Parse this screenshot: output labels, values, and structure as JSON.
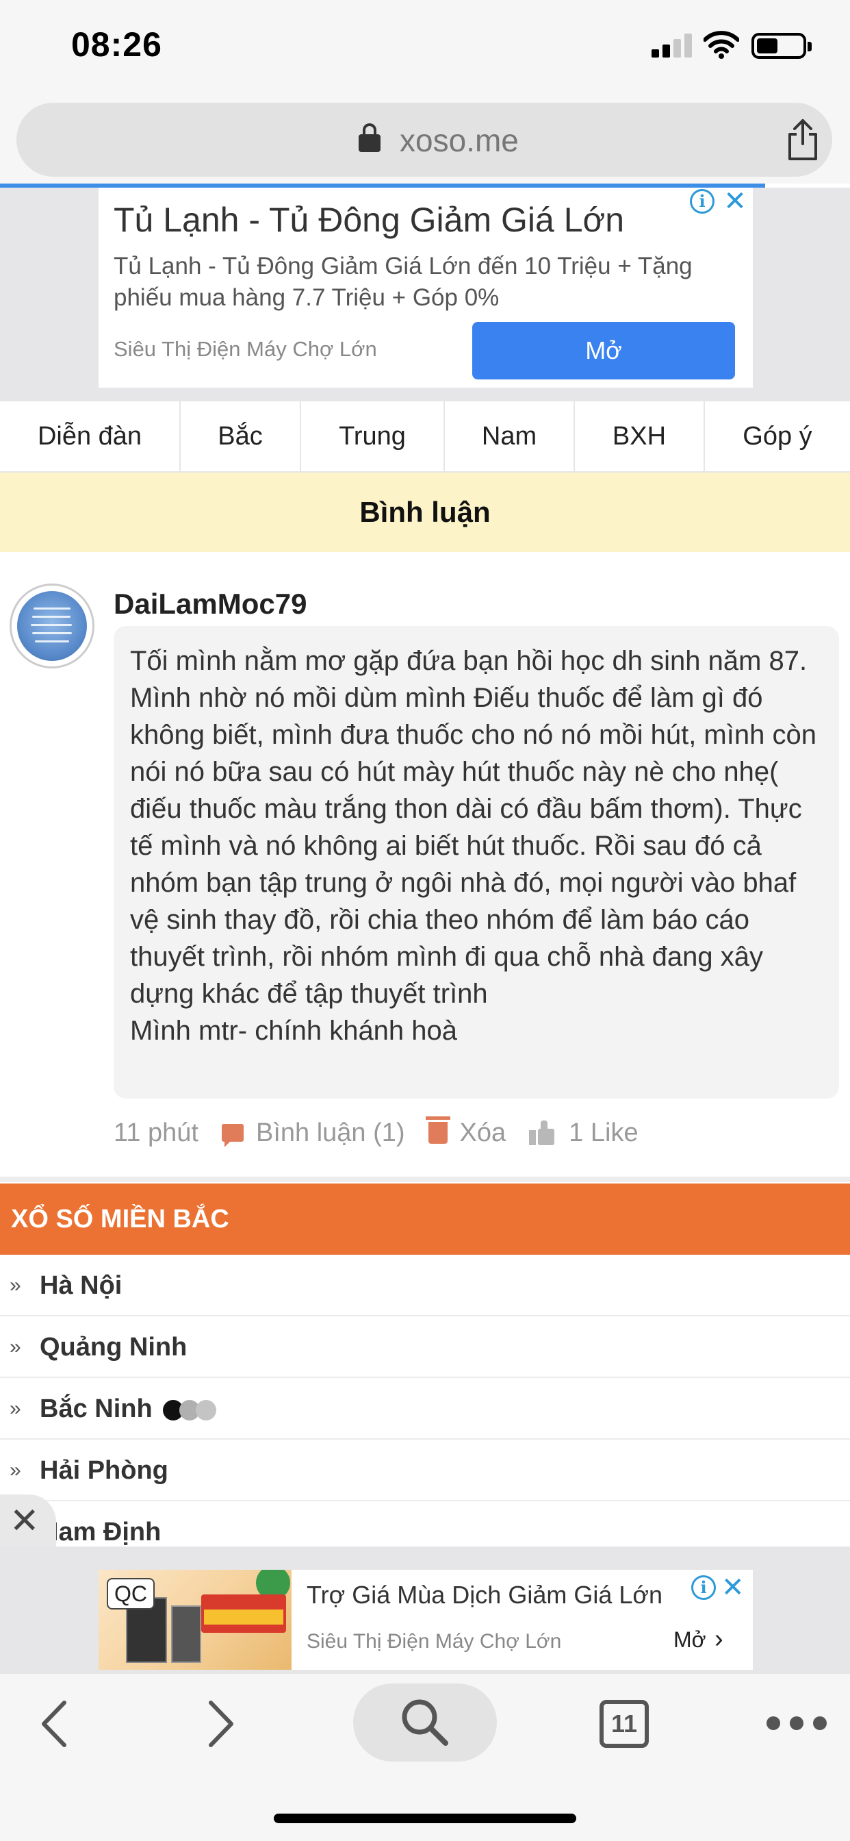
{
  "status_bar": {
    "time": "08:26"
  },
  "browser": {
    "url": "xoso.me",
    "open_tabs": "11"
  },
  "top_ad": {
    "title": "Tủ Lạnh - Tủ Đông Giảm Giá Lớn",
    "description": "Tủ Lạnh - Tủ Đông Giảm Giá Lớn đến 10 Triệu + Tặng phiếu mua hàng 7.7 Triệu + Góp 0%",
    "source": "Siêu Thị Điện Máy Chợ Lớn",
    "button": "Mở"
  },
  "nav": {
    "items": [
      "Diễn đàn",
      "Bắc",
      "Trung",
      "Nam",
      "BXH",
      "Góp ý"
    ]
  },
  "section": {
    "title": "Bình luận"
  },
  "comment": {
    "username": "DaiLamMoc79",
    "paragraphs": [
      "Tối mình nằm mơ gặp đứa bạn hồi học dh sinh năm 87. Mình nhờ nó mồi dùm mình Điếu thuốc để làm gì đó không biết, mình đưa thuốc cho nó nó mồi hút, mình còn nói nó bữa sau có hút mày hút thuốc này nè cho nhẹ( điếu thuốc màu trắng thon dài có đầu bấm thơm). Thực tế mình và nó không ai biết hút thuốc. Rồi sau đó cả nhóm bạn tập trung ở ngôi nhà đó, mọi người vào bhaf vệ sinh thay đồ, rồi chia theo nhóm để làm báo cáo thuyết trình, rồi nhóm mình đi qua chỗ nhà đang xây dựng khác để tập thuyết trình",
      "Mình mtr- chính khánh hoà"
    ],
    "time": "11 phút",
    "reply_label": "Bình luận (1)",
    "delete_label": "Xóa",
    "like_label": "1 Like"
  },
  "lottery": {
    "header": "XỔ SỐ MIỀN BẮC",
    "arrow_glyph": "»",
    "provinces": [
      "Hà Nội",
      "Quảng Ninh",
      "Bắc Ninh",
      "Hải Phòng",
      "Nam Định"
    ]
  },
  "bottom_ad": {
    "badge": "QC",
    "title": "Trợ Giá Mùa Dịch Giảm Giá Lớn",
    "source": "Siêu Thị Điện Máy Chợ Lớn",
    "button": "Mở"
  },
  "colors": {
    "accent_orange": "#eb7232",
    "section_bg": "#fdf3c8",
    "ad_button": "#3b82f1",
    "progress": "#3d8ee6",
    "action_icon": "#e07c5a"
  }
}
